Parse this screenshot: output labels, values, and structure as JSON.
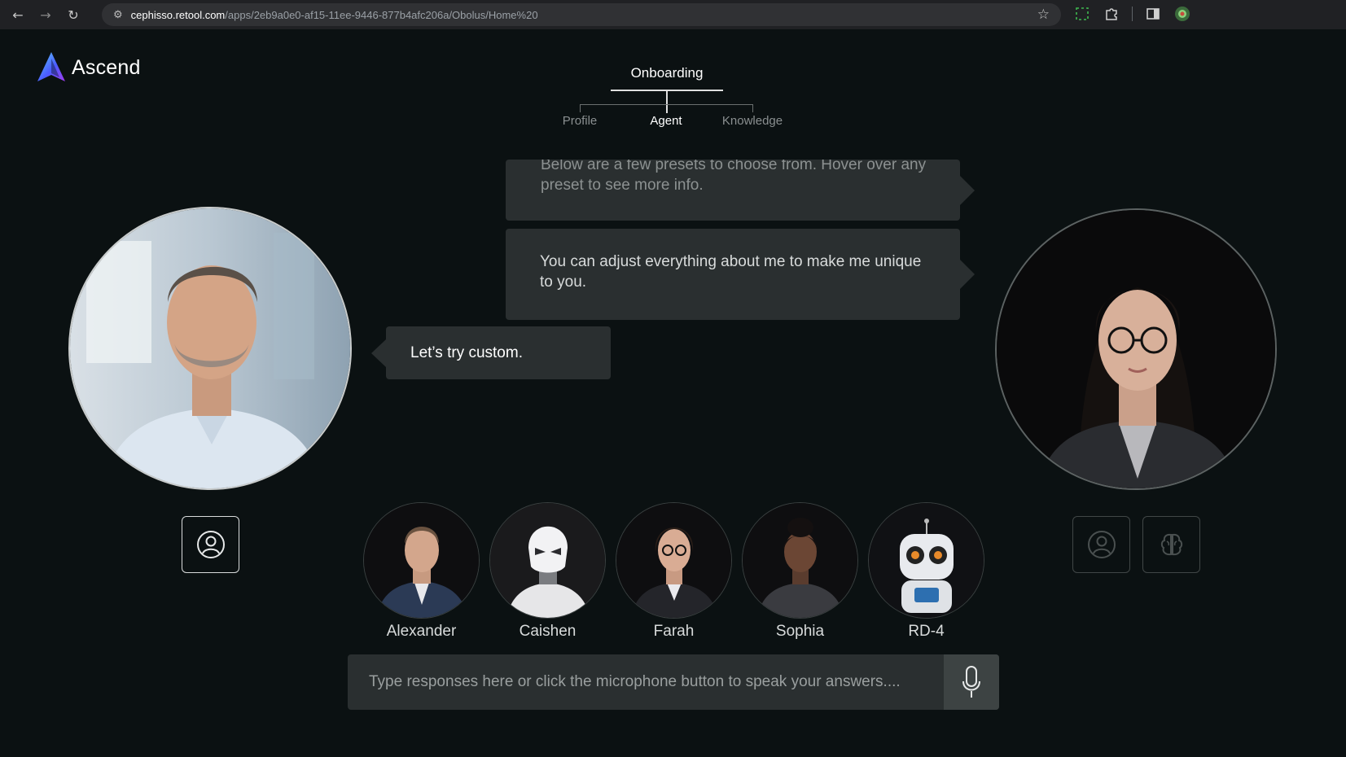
{
  "browser": {
    "url_host": "cephisso.retool.com",
    "url_path": "/apps/2eb9a0e0-af15-11ee-9446-877b4afc206a/Obolus/Home%20"
  },
  "app": {
    "logo_text": "Ascend"
  },
  "stepper": {
    "title": "Onboarding",
    "steps": [
      {
        "label": "Profile",
        "state": "inactive"
      },
      {
        "label": "Agent",
        "state": "active"
      },
      {
        "label": "Knowledge",
        "state": "inactive"
      }
    ]
  },
  "chat": {
    "messages": [
      {
        "from": "agent",
        "text": "Below are a few presets to choose from. Hover over any preset to see more info."
      },
      {
        "from": "agent",
        "text": "You can adjust everything about me to make me unique to you."
      },
      {
        "from": "user",
        "text": "Let’s try custom."
      }
    ]
  },
  "presets": [
    {
      "name": "Alexander"
    },
    {
      "name": "Caishen"
    },
    {
      "name": "Farah"
    },
    {
      "name": "Sophia"
    },
    {
      "name": "RD-4"
    }
  ],
  "input": {
    "placeholder": "Type responses here or click the microphone button to speak your answers...."
  },
  "colors": {
    "background": "#0b1112",
    "bubble": "#2a2f30",
    "mic_button": "#3d4343"
  }
}
